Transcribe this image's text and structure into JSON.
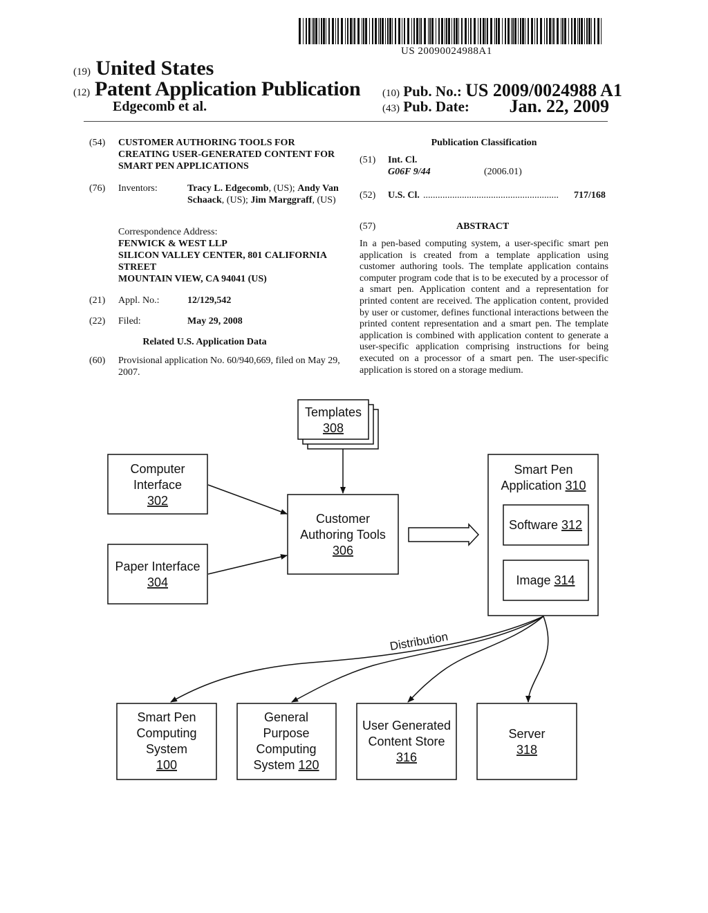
{
  "header": {
    "barcode_number": "US 20090024988A1",
    "country_code": "(19)",
    "country": "United States",
    "doc_type_code": "(12)",
    "doc_type": "Patent Application Publication",
    "authors": "Edgecomb et al.",
    "pub_no_code": "(10)",
    "pub_no_label": "Pub. No.:",
    "pub_no": "US 2009/0024988 A1",
    "pub_date_code": "(43)",
    "pub_date_label": "Pub. Date:",
    "pub_date": "Jan. 22, 2009"
  },
  "left_column": {
    "title_code": "(54)",
    "title": "CUSTOMER AUTHORING TOOLS FOR CREATING USER-GENERATED CONTENT FOR SMART PEN APPLICATIONS",
    "inventors_code": "(76)",
    "inventors_label": "Inventors:",
    "inventors": [
      {
        "name": "Tracy L. Edgecomb",
        "country": ", (US); "
      },
      {
        "name": "Andy Van Schaack",
        "country": ", (US); "
      },
      {
        "name": "Jim Marggraff",
        "country": ", (US)"
      }
    ],
    "correspondence_label": "Correspondence Address:",
    "correspondence_lines": [
      "FENWICK & WEST LLP",
      "SILICON VALLEY CENTER, 801 CALIFORNIA",
      "STREET",
      "MOUNTAIN VIEW, CA 94041 (US)"
    ],
    "appl_code": "(21)",
    "appl_label": "Appl. No.:",
    "appl_no": "12/129,542",
    "filed_code": "(22)",
    "filed_label": "Filed:",
    "filed_date": "May 29, 2008",
    "related_heading": "Related U.S. Application Data",
    "provisional_code": "(60)",
    "provisional_text": "Provisional application No. 60/940,669, filed on May 29, 2007."
  },
  "right_column": {
    "classification_heading": "Publication Classification",
    "int_cl_code": "(51)",
    "int_cl_label": "Int. Cl.",
    "int_cl_value": "G06F 9/44",
    "int_cl_version": "(2006.01)",
    "us_cl_code": "(52)",
    "us_cl_label": "U.S. Cl.",
    "us_cl_dots": "........................................................",
    "us_cl_value": "717/168",
    "abstract_code": "(57)",
    "abstract_heading": "ABSTRACT",
    "abstract": "In a pen-based computing system, a user-specific smart pen application is created from a template application using customer authoring tools. The template application contains computer program code that is to be executed by a processor of a smart pen. Application content and a representation for printed content are received. The application content, provided by user or customer, defines functional interactions between the printed content representation and a smart pen. The template application is combined with application content to generate a user-specific application comprising instructions for being executed on a processor of a smart pen. The user-specific application is stored on a storage medium."
  },
  "diagram": {
    "templates": {
      "lines": [
        "Templates"
      ],
      "ref": "308"
    },
    "computer_interface": {
      "lines": [
        "Computer",
        "Interface"
      ],
      "ref": "302"
    },
    "paper_interface": {
      "lines": [
        "Paper Interface"
      ],
      "ref": "304"
    },
    "authoring_tools": {
      "lines": [
        "Customer",
        "Authoring Tools"
      ],
      "ref": "306"
    },
    "smart_pen_app": {
      "line1": "Smart Pen",
      "line2": "Application ",
      "ref": "310"
    },
    "software": {
      "label": "Software ",
      "ref": "312"
    },
    "image": {
      "label": "Image ",
      "ref": "314"
    },
    "distribution_label": "Distribution",
    "targets": [
      {
        "lines": [
          "Smart Pen",
          "Computing",
          "System"
        ],
        "ref": "100",
        "ref_inline": false
      },
      {
        "lines": [
          "General",
          "Purpose",
          "Computing",
          "System "
        ],
        "ref": "120",
        "ref_inline": true
      },
      {
        "lines": [
          "User Generated",
          "Content Store"
        ],
        "ref": "316",
        "ref_inline": false
      },
      {
        "lines": [
          "Server"
        ],
        "ref": "318",
        "ref_inline": false
      }
    ]
  }
}
